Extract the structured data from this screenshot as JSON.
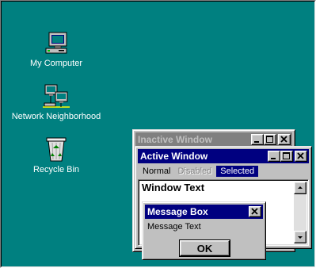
{
  "desktop": {
    "background": "#008080",
    "icons": [
      {
        "label": "My Computer",
        "icon": "my-computer-icon"
      },
      {
        "label": "Network Neighborhood",
        "icon": "network-neighborhood-icon"
      },
      {
        "label": "Recycle Bin",
        "icon": "recycle-bin-icon"
      }
    ]
  },
  "colors": {
    "active_title": "#000080",
    "inactive_title": "#808080",
    "inactive_title_text": "#c0c0c0",
    "window_face": "#c0c0c0",
    "selected_bg": "#000080",
    "disabled_text": "#808080"
  },
  "inactive_window": {
    "title": "Inactive Window"
  },
  "active_window": {
    "title": "Active Window",
    "menu": {
      "normal": "Normal",
      "disabled": "Disabled",
      "selected": "Selected"
    },
    "window_text": "Window Text"
  },
  "message_box": {
    "title": "Message Box",
    "text": "Message Text",
    "ok_label": "OK"
  }
}
